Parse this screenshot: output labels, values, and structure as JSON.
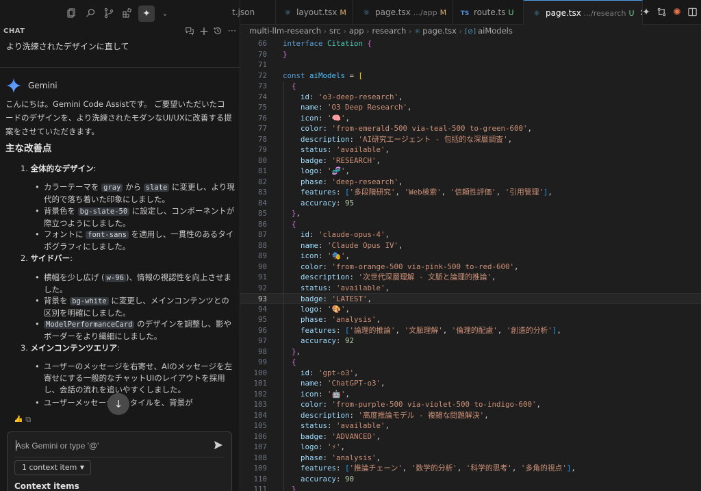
{
  "chat": {
    "header_title": "CHAT",
    "user_message": "より洗練されたデザインに直して",
    "assistant_name": "Gemini",
    "intro": "こんにちは。Gemini Code Assistです。 ご要望いただいたコードのデザインを、より洗練されたモダンなUI/UXに改善する提案をさせていただきます。",
    "heading": "主な改善点",
    "sections": [
      {
        "number": "1.",
        "title": "全体的なデザイン",
        "bullets": [
          {
            "parts": [
              {
                "t": "カラーテーマを "
              },
              {
                "c": "gray"
              },
              {
                "t": " から "
              },
              {
                "c": "slate"
              },
              {
                "t": " に変更し、より現代的で落ち着いた印象にしました。"
              }
            ]
          },
          {
            "parts": [
              {
                "t": "背景色を "
              },
              {
                "c": "bg-slate-50"
              },
              {
                "t": " に設定し、コンポーネントが際立つようにしました。"
              }
            ]
          },
          {
            "parts": [
              {
                "t": "フォントに "
              },
              {
                "c": "font-sans"
              },
              {
                "t": " を適用し、一貫性のあるタイポグラフィにしました。"
              }
            ]
          }
        ]
      },
      {
        "number": "2.",
        "title": "サイドバー",
        "bullets": [
          {
            "parts": [
              {
                "t": "横幅を少し広げ ("
              },
              {
                "c": "w-96"
              },
              {
                "t": ")、情報の視認性を向上させました。"
              }
            ]
          },
          {
            "parts": [
              {
                "t": "背景を "
              },
              {
                "c": "bg-white"
              },
              {
                "t": " に変更し、メインコンテンツとの区別を明確にしました。"
              }
            ]
          },
          {
            "parts": [
              {
                "c": "ModelPerformanceCard"
              },
              {
                "t": " のデザインを調整し、影やボーダーをより繊細にしました。"
              }
            ]
          }
        ]
      },
      {
        "number": "3.",
        "title": "メインコンテンツエリア",
        "bullets": [
          {
            "parts": [
              {
                "t": "ユーザーのメッセージを右寄せ、AIのメッセージを左寄せにする一般的なチャットUIのレイアウトを採用し、会話の流れを追いやすくしました。"
              }
            ]
          },
          {
            "parts": [
              {
                "t": "ユーザーメッセージのスタイルを、背景が"
              }
            ]
          }
        ]
      }
    ],
    "input_placeholder": "Ask Gemini or type '@'",
    "context_chip": "1 context item",
    "context_items_label": "Context items"
  },
  "tabs": [
    {
      "icon": "",
      "name": "t.json",
      "sub": "",
      "mark": "",
      "active": false
    },
    {
      "icon": "react-icon",
      "name": "layout.tsx",
      "sub": "",
      "mark": "M",
      "active": false
    },
    {
      "icon": "react-icon",
      "name": "page.tsx",
      "sub": ".../app",
      "mark": "M",
      "active": false
    },
    {
      "icon": "ts-icon",
      "name": "route.ts",
      "sub": "",
      "mark": "U",
      "active": false
    },
    {
      "icon": "react-icon",
      "name": "page.tsx",
      "sub": ".../research",
      "mark": "U",
      "active": true
    }
  ],
  "breadcrumb": [
    "multi-llm-research",
    "src",
    "app",
    "research",
    "page.tsx",
    "aiModels"
  ],
  "editor": {
    "current_line": 93,
    "lines": [
      {
        "n": 66,
        "tokens": [
          [
            "kw",
            "interface "
          ],
          [
            "type",
            "Citation "
          ],
          [
            "br2",
            "{"
          ]
        ]
      },
      {
        "n": 70,
        "tokens": [
          [
            "br2",
            "}"
          ]
        ]
      },
      {
        "n": 71,
        "tokens": []
      },
      {
        "n": 72,
        "tokens": [
          [
            "kw",
            "const "
          ],
          [
            "var",
            "aiModels"
          ],
          [
            "p",
            " = "
          ],
          [
            "br",
            "["
          ]
        ]
      },
      {
        "n": 73,
        "tokens": [
          [
            "br2",
            "  {"
          ]
        ]
      },
      {
        "n": 74,
        "tokens": [
          [
            "prop",
            "    id"
          ],
          [
            "p",
            ": "
          ],
          [
            "str",
            "'o3-deep-research'"
          ],
          [
            "p",
            ","
          ]
        ]
      },
      {
        "n": 75,
        "tokens": [
          [
            "prop",
            "    name"
          ],
          [
            "p",
            ": "
          ],
          [
            "str",
            "'O3 Deep Research'"
          ],
          [
            "p",
            ","
          ]
        ]
      },
      {
        "n": 76,
        "tokens": [
          [
            "prop",
            "    icon"
          ],
          [
            "p",
            ": "
          ],
          [
            "str",
            "'🧠'"
          ],
          [
            "p",
            ","
          ]
        ]
      },
      {
        "n": 77,
        "tokens": [
          [
            "prop",
            "    color"
          ],
          [
            "p",
            ": "
          ],
          [
            "str",
            "'from-emerald-500 via-teal-500 to-green-600'"
          ],
          [
            "p",
            ","
          ]
        ]
      },
      {
        "n": 78,
        "tokens": [
          [
            "prop",
            "    description"
          ],
          [
            "p",
            ": "
          ],
          [
            "str",
            "'AI研究エージェント - 包括的な深層調査'"
          ],
          [
            "p",
            ","
          ]
        ]
      },
      {
        "n": 79,
        "tokens": [
          [
            "prop",
            "    status"
          ],
          [
            "p",
            ": "
          ],
          [
            "str",
            "'available'"
          ],
          [
            "p",
            ","
          ]
        ]
      },
      {
        "n": 80,
        "tokens": [
          [
            "prop",
            "    badge"
          ],
          [
            "p",
            ": "
          ],
          [
            "str",
            "'RESEARCH'"
          ],
          [
            "p",
            ","
          ]
        ]
      },
      {
        "n": 81,
        "tokens": [
          [
            "prop",
            "    logo"
          ],
          [
            "p",
            ": "
          ],
          [
            "str",
            "'🧬'"
          ],
          [
            "p",
            ","
          ]
        ]
      },
      {
        "n": 82,
        "tokens": [
          [
            "prop",
            "    phase"
          ],
          [
            "p",
            ": "
          ],
          [
            "str",
            "'deep-research'"
          ],
          [
            "p",
            ","
          ]
        ]
      },
      {
        "n": 83,
        "tokens": [
          [
            "prop",
            "    features"
          ],
          [
            "p",
            ": "
          ],
          [
            "br3",
            "["
          ],
          [
            "str",
            "'多段階研究'"
          ],
          [
            "p",
            ", "
          ],
          [
            "str",
            "'Web検索'"
          ],
          [
            "p",
            ", "
          ],
          [
            "str",
            "'信頼性評価'"
          ],
          [
            "p",
            ", "
          ],
          [
            "str",
            "'引用管理'"
          ],
          [
            "br3",
            "]"
          ],
          [
            "p",
            ","
          ]
        ]
      },
      {
        "n": 84,
        "tokens": [
          [
            "prop",
            "    accuracy"
          ],
          [
            "p",
            ": "
          ],
          [
            "num",
            "95"
          ]
        ]
      },
      {
        "n": 85,
        "tokens": [
          [
            "br2",
            "  }"
          ],
          [
            "p",
            ","
          ]
        ]
      },
      {
        "n": 86,
        "tokens": [
          [
            "br2",
            "  {"
          ]
        ]
      },
      {
        "n": 87,
        "tokens": [
          [
            "prop",
            "    id"
          ],
          [
            "p",
            ": "
          ],
          [
            "str",
            "'claude-opus-4'"
          ],
          [
            "p",
            ","
          ]
        ]
      },
      {
        "n": 88,
        "tokens": [
          [
            "prop",
            "    name"
          ],
          [
            "p",
            ": "
          ],
          [
            "str",
            "'Claude Opus IV'"
          ],
          [
            "p",
            ","
          ]
        ]
      },
      {
        "n": 89,
        "tokens": [
          [
            "prop",
            "    icon"
          ],
          [
            "p",
            ": "
          ],
          [
            "str",
            "'🎭'"
          ],
          [
            "p",
            ","
          ]
        ]
      },
      {
        "n": 90,
        "tokens": [
          [
            "prop",
            "    color"
          ],
          [
            "p",
            ": "
          ],
          [
            "str",
            "'from-orange-500 via-pink-500 to-red-600'"
          ],
          [
            "p",
            ","
          ]
        ]
      },
      {
        "n": 91,
        "tokens": [
          [
            "prop",
            "    description"
          ],
          [
            "p",
            ": "
          ],
          [
            "str",
            "'次世代深層理解 - 文脈と論理的推論'"
          ],
          [
            "p",
            ","
          ]
        ]
      },
      {
        "n": 92,
        "tokens": [
          [
            "prop",
            "    status"
          ],
          [
            "p",
            ": "
          ],
          [
            "str",
            "'available'"
          ],
          [
            "p",
            ","
          ]
        ]
      },
      {
        "n": 93,
        "tokens": [
          [
            "prop",
            "    badge"
          ],
          [
            "p",
            ": "
          ],
          [
            "str",
            "'LATEST'"
          ],
          [
            "p",
            ","
          ]
        ]
      },
      {
        "n": 94,
        "tokens": [
          [
            "prop",
            "    logo"
          ],
          [
            "p",
            ": "
          ],
          [
            "str",
            "'🎨'"
          ],
          [
            "p",
            ","
          ]
        ]
      },
      {
        "n": 95,
        "tokens": [
          [
            "prop",
            "    phase"
          ],
          [
            "p",
            ": "
          ],
          [
            "str",
            "'analysis'"
          ],
          [
            "p",
            ","
          ]
        ]
      },
      {
        "n": 96,
        "tokens": [
          [
            "prop",
            "    features"
          ],
          [
            "p",
            ": "
          ],
          [
            "br3",
            "["
          ],
          [
            "str",
            "'論理的推論'"
          ],
          [
            "p",
            ", "
          ],
          [
            "str",
            "'文脈理解'"
          ],
          [
            "p",
            ", "
          ],
          [
            "str",
            "'倫理的配慮'"
          ],
          [
            "p",
            ", "
          ],
          [
            "str",
            "'創造的分析'"
          ],
          [
            "br3",
            "]"
          ],
          [
            "p",
            ","
          ]
        ]
      },
      {
        "n": 97,
        "tokens": [
          [
            "prop",
            "    accuracy"
          ],
          [
            "p",
            ": "
          ],
          [
            "num",
            "92"
          ]
        ]
      },
      {
        "n": 98,
        "tokens": [
          [
            "br2",
            "  }"
          ],
          [
            "p",
            ","
          ]
        ]
      },
      {
        "n": 99,
        "tokens": [
          [
            "br2",
            "  {"
          ]
        ]
      },
      {
        "n": 100,
        "tokens": [
          [
            "prop",
            "    id"
          ],
          [
            "p",
            ": "
          ],
          [
            "str",
            "'gpt-o3'"
          ],
          [
            "p",
            ","
          ]
        ]
      },
      {
        "n": 101,
        "tokens": [
          [
            "prop",
            "    name"
          ],
          [
            "p",
            ": "
          ],
          [
            "str",
            "'ChatGPT-o3'"
          ],
          [
            "p",
            ","
          ]
        ]
      },
      {
        "n": 102,
        "tokens": [
          [
            "prop",
            "    icon"
          ],
          [
            "p",
            ": "
          ],
          [
            "str",
            "'🤖'"
          ],
          [
            "p",
            ","
          ]
        ]
      },
      {
        "n": 103,
        "tokens": [
          [
            "prop",
            "    color"
          ],
          [
            "p",
            ": "
          ],
          [
            "str",
            "'from-purple-500 via-violet-500 to-indigo-600'"
          ],
          [
            "p",
            ","
          ]
        ]
      },
      {
        "n": 104,
        "tokens": [
          [
            "prop",
            "    description"
          ],
          [
            "p",
            ": "
          ],
          [
            "str",
            "'高度推論モデル - 複雑な問題解決'"
          ],
          [
            "p",
            ","
          ]
        ]
      },
      {
        "n": 105,
        "tokens": [
          [
            "prop",
            "    status"
          ],
          [
            "p",
            ": "
          ],
          [
            "str",
            "'available'"
          ],
          [
            "p",
            ","
          ]
        ]
      },
      {
        "n": 106,
        "tokens": [
          [
            "prop",
            "    badge"
          ],
          [
            "p",
            ": "
          ],
          [
            "str",
            "'ADVANCED'"
          ],
          [
            "p",
            ","
          ]
        ]
      },
      {
        "n": 107,
        "tokens": [
          [
            "prop",
            "    logo"
          ],
          [
            "p",
            ": "
          ],
          [
            "str",
            "'⚡'"
          ],
          [
            "p",
            ","
          ]
        ]
      },
      {
        "n": 108,
        "tokens": [
          [
            "prop",
            "    phase"
          ],
          [
            "p",
            ": "
          ],
          [
            "str",
            "'analysis'"
          ],
          [
            "p",
            ","
          ]
        ]
      },
      {
        "n": 109,
        "tokens": [
          [
            "prop",
            "    features"
          ],
          [
            "p",
            ": "
          ],
          [
            "br3",
            "["
          ],
          [
            "str",
            "'推論チェーン'"
          ],
          [
            "p",
            ", "
          ],
          [
            "str",
            "'数学的分析'"
          ],
          [
            "p",
            ", "
          ],
          [
            "str",
            "'科学的思考'"
          ],
          [
            "p",
            ", "
          ],
          [
            "str",
            "'多角的視点'"
          ],
          [
            "br3",
            "]"
          ],
          [
            "p",
            ","
          ]
        ]
      },
      {
        "n": 110,
        "tokens": [
          [
            "prop",
            "    accuracy"
          ],
          [
            "p",
            ": "
          ],
          [
            "num",
            "90"
          ]
        ]
      },
      {
        "n": 111,
        "tokens": [
          [
            "br2",
            "  }"
          ]
        ]
      }
    ]
  },
  "colors": {
    "accent": "#4d9fe8",
    "modified": "#d9b36b",
    "untracked": "#73c991",
    "gemini_blue": "#4285f4"
  }
}
